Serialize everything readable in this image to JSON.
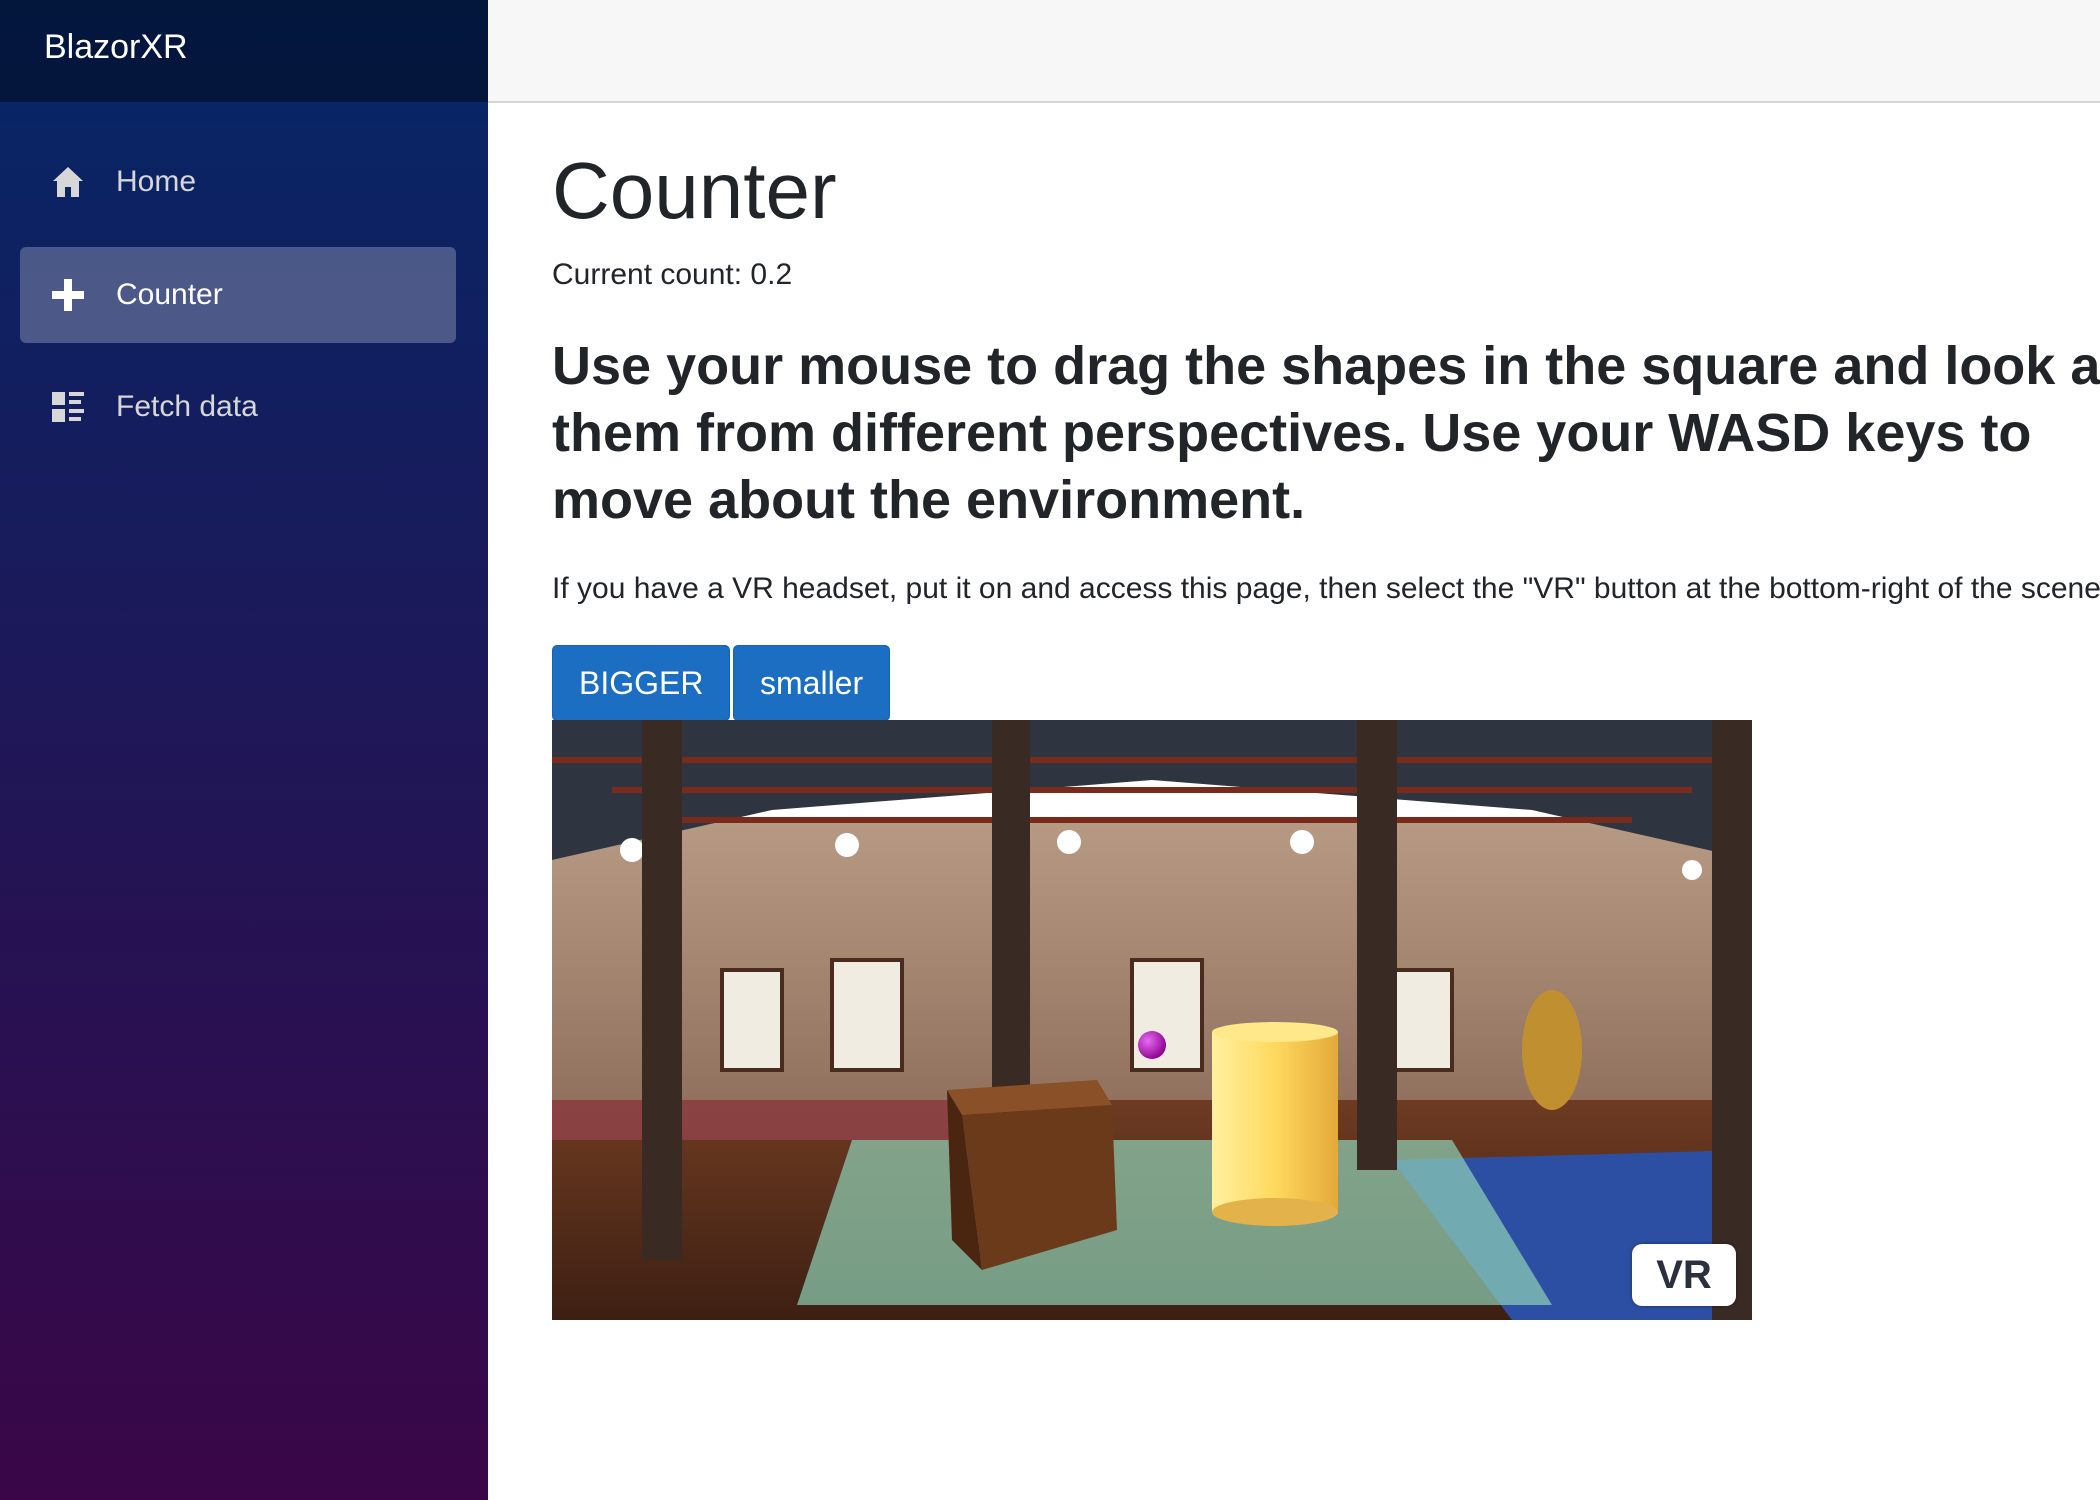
{
  "app": {
    "brand": "BlazorXR"
  },
  "sidebar": {
    "items": [
      {
        "label": "Home",
        "icon": "home-icon",
        "active": false
      },
      {
        "label": "Counter",
        "icon": "plus-icon",
        "active": true
      },
      {
        "label": "Fetch data",
        "icon": "list-rich-icon",
        "active": false
      }
    ]
  },
  "main": {
    "title": "Counter",
    "count_text": "Current count: 0.2",
    "instructions": "Use your mouse to drag the shapes in the square and look at them from different perspectives. Use your WASD keys to move about the environment.",
    "vr_note": "If you have a VR headset, put it on and access this page, then select the \"VR\" button at the bottom-right of the scene.",
    "buttons": {
      "bigger": "BIGGER",
      "smaller": "smaller"
    },
    "scene": {
      "vr_button": "VR"
    }
  },
  "colors": {
    "sidebar_top": "#052767",
    "sidebar_bottom": "#3a0647",
    "primary": "#1b6ec2",
    "cylinder": "#ffd95e",
    "sphere": "#b100b8",
    "box": "#6b3a1a"
  }
}
